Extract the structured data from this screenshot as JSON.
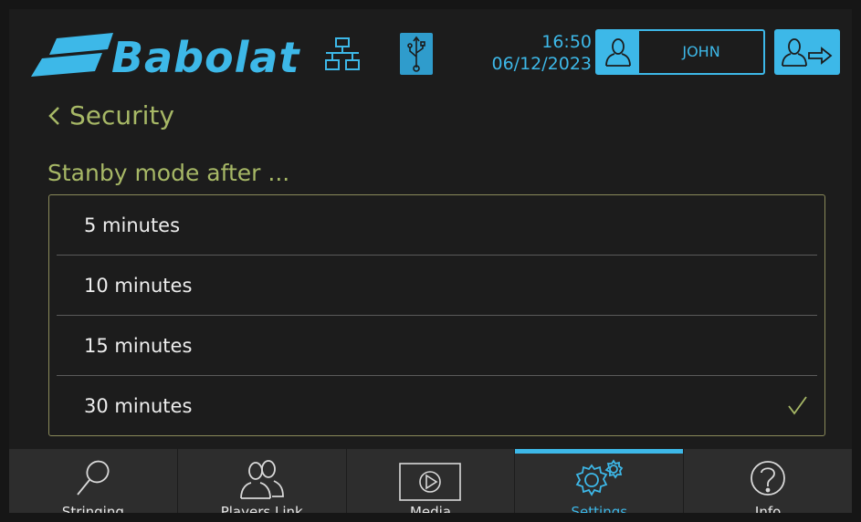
{
  "header": {
    "brand": "Babolat",
    "time": "16:50",
    "date": "06/12/2023",
    "user_name": "JOHN",
    "icons": [
      "network-icon",
      "usb-icon",
      "user-icon",
      "logout-icon"
    ]
  },
  "page": {
    "back_label": "Security",
    "subtitle": "Stanby mode after ..."
  },
  "options": [
    {
      "label": "5 minutes",
      "selected": false
    },
    {
      "label": "10 minutes",
      "selected": false
    },
    {
      "label": "15 minutes",
      "selected": false
    },
    {
      "label": "30 minutes",
      "selected": true
    }
  ],
  "nav": [
    {
      "label": "Stringing",
      "icon": "racket-icon",
      "active": false
    },
    {
      "label": "Players Link",
      "icon": "players-icon",
      "active": false
    },
    {
      "label": "Media",
      "icon": "play-icon",
      "active": false
    },
    {
      "label": "Settings",
      "icon": "gears-icon",
      "active": true
    },
    {
      "label": "Info",
      "icon": "question-icon",
      "active": false
    }
  ],
  "colors": {
    "accent": "#3db8e8",
    "heading": "#a7b866",
    "background": "#1c1c1c"
  }
}
